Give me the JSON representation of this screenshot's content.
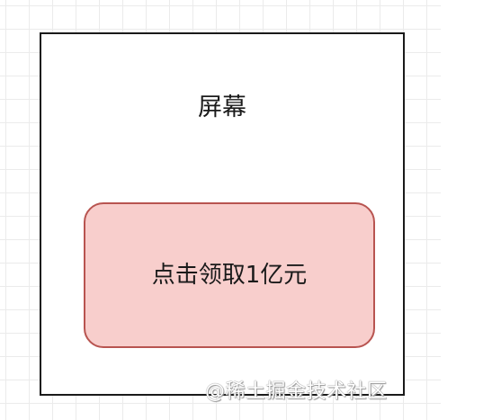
{
  "diagram": {
    "screen_label": "屏幕",
    "reward_button_label": "点击领取1亿元"
  },
  "watermark": {
    "text": "@稀土掘金技术社区"
  },
  "colors": {
    "frame_border": "#1a1a1a",
    "button_fill": "#f8cecc",
    "button_border": "#b85450",
    "grid_line": "#ebebeb"
  }
}
